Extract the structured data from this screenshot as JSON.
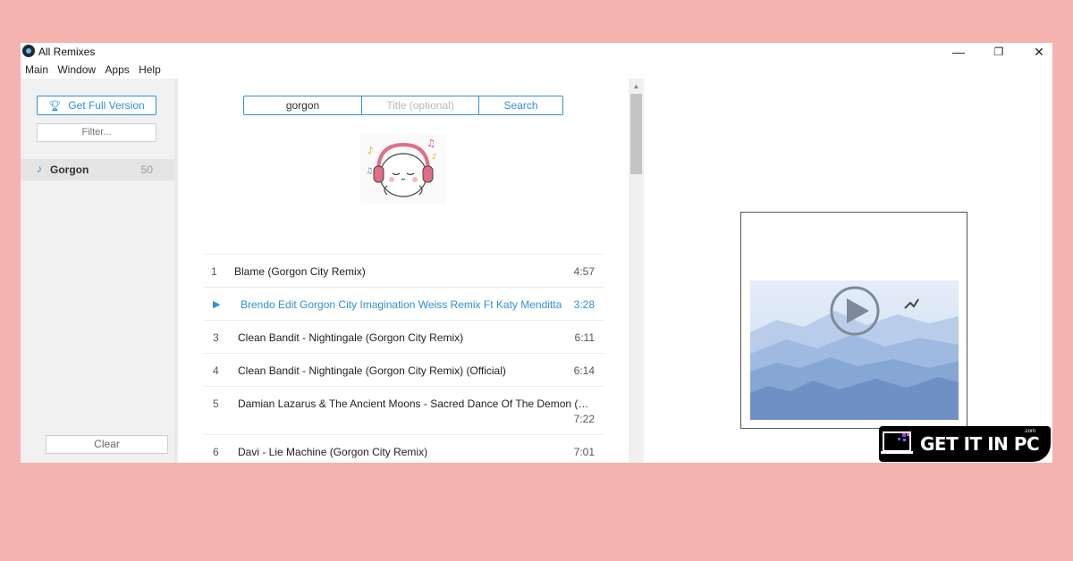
{
  "window": {
    "title": "All Remixes",
    "controls": {
      "minimize": "—",
      "restore": "❐",
      "close": "✕"
    }
  },
  "menu": [
    "Main",
    "Window",
    "Apps",
    "Help"
  ],
  "sidebar": {
    "full_version_label": "Get Full Version",
    "filter_placeholder": "Filter...",
    "artists": [
      {
        "name": "Gorgon",
        "count": "50"
      }
    ],
    "clear_label": "Clear"
  },
  "search": {
    "query_value": "gorgon",
    "title_placeholder": "Title (optional)",
    "button_label": "Search"
  },
  "tracks": [
    {
      "num": "1",
      "title": "Blame (Gorgon City Remix)",
      "duration": "4:57"
    },
    {
      "num": "▶",
      "title": "Brendo Edit Gorgon City Imagination Weiss Remix Ft Katy Menditta",
      "duration": "3:28",
      "playing": true
    },
    {
      "num": "3",
      "title": "Clean Bandit - Nightingale (Gorgon City Remix)",
      "duration": "6:11"
    },
    {
      "num": "4",
      "title": "Clean Bandit - Nightingale (Gorgon City Remix) (Official)",
      "duration": "6:14"
    },
    {
      "num": "5",
      "title": "Damian Lazarus & The Ancient Moons - Sacred Dance Of The Demon (Gor…",
      "duration": "7:22"
    },
    {
      "num": "6",
      "title": "Davi - Lie Machine (Gorgon City Remix)",
      "duration": "7:01"
    }
  ],
  "icons": {
    "app": "disc-icon",
    "full_version": "trophy-icon",
    "artist": "music-note-icon",
    "playing": "play-icon",
    "video": "play-circle-icon"
  },
  "watermark": {
    "text": "GET IT IN PC",
    "suffix": ".com"
  },
  "colors": {
    "accent": "#2f8fd8",
    "background": "#f5b2b0"
  }
}
